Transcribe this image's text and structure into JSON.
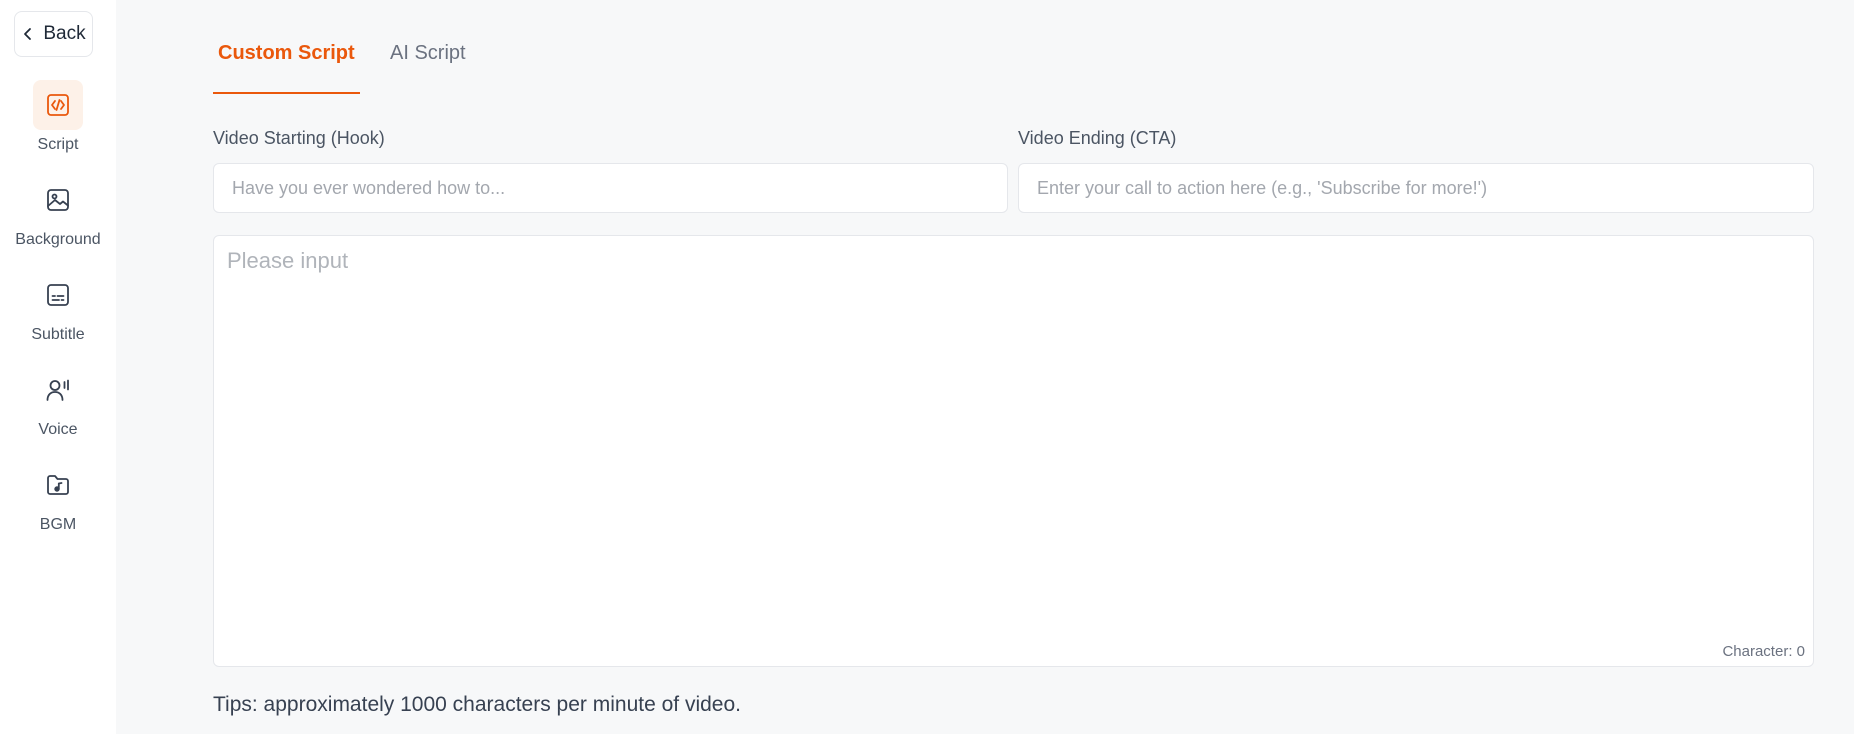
{
  "sidebar": {
    "back_label": "Back",
    "items": [
      {
        "label": "Script",
        "icon": "code-icon"
      },
      {
        "label": "Background",
        "icon": "image-icon"
      },
      {
        "label": "Subtitle",
        "icon": "subtitle-icon"
      },
      {
        "label": "Voice",
        "icon": "voice-icon"
      },
      {
        "label": "BGM",
        "icon": "music-folder-icon"
      }
    ],
    "accent_color": "#ea580c"
  },
  "tabs": [
    {
      "label": "Custom Script",
      "active": true
    },
    {
      "label": "AI Script",
      "active": false
    }
  ],
  "form": {
    "hook_label": "Video Starting (Hook)",
    "hook_placeholder": "Have you ever wondered how to...",
    "cta_label": "Video Ending (CTA)",
    "cta_placeholder": "Enter your call to action here (e.g., 'Subscribe for more!')",
    "script_placeholder": "Please input",
    "char_count": "Character: 0"
  },
  "tips": "Tips: approximately 1000 characters per minute of video."
}
